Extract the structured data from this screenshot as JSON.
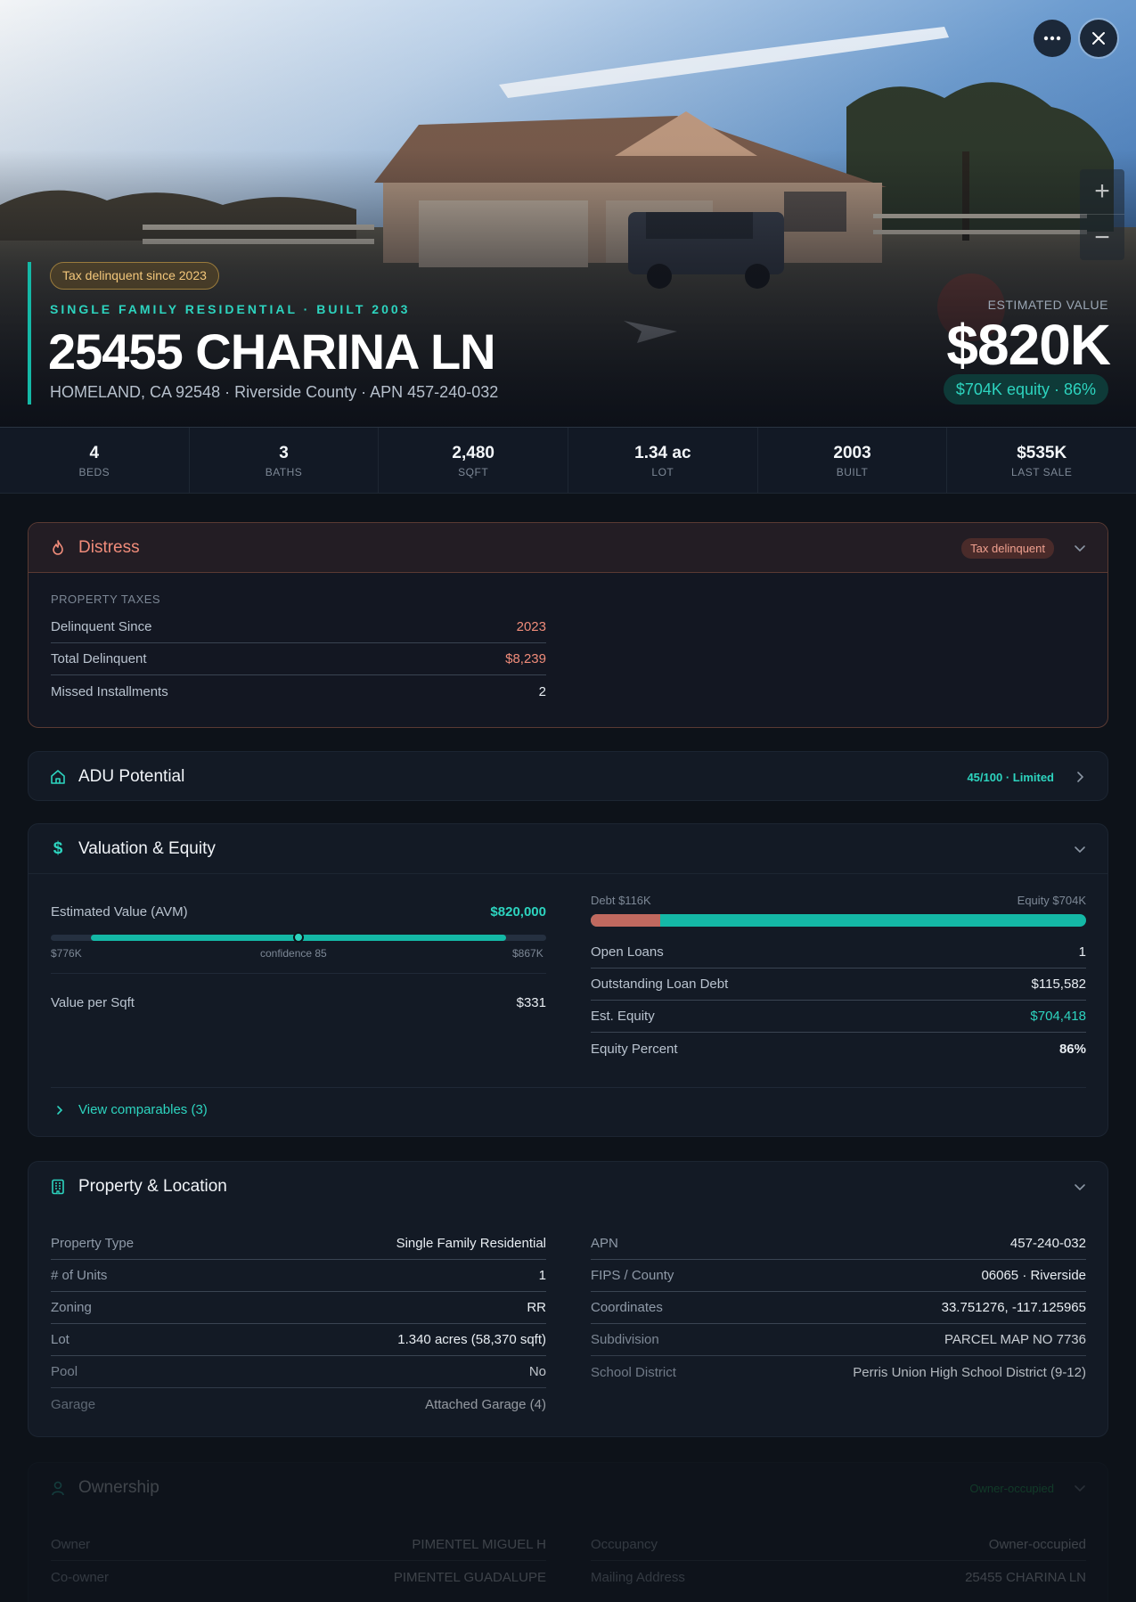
{
  "hero": {
    "tax_chip": "Tax delinquent since 2023",
    "kicker": "SINGLE FAMILY RESIDENTIAL · BUILT 2003",
    "address": "25455 CHARINA LN",
    "subline": "HOMELAND, CA 92548 · Riverside County · APN 457-240-032",
    "estimated_label": "ESTIMATED VALUE",
    "estimated_value": "$820K",
    "equity_pill": "$704K equity · 86%",
    "icons": {
      "more": "more-horizontal-icon",
      "close": "close-icon",
      "zoom_in": "plus-icon",
      "zoom_out": "minus-icon"
    }
  },
  "stats": [
    {
      "value": "4",
      "label": "BEDS"
    },
    {
      "value": "3",
      "label": "BATHS"
    },
    {
      "value": "2,480",
      "label": "SQFT"
    },
    {
      "value": "1.34 ac",
      "label": "LOT"
    },
    {
      "value": "2003",
      "label": "BUILT"
    },
    {
      "value": "$535K",
      "label": "LAST SALE"
    }
  ],
  "distress": {
    "title": "Distress",
    "badge": "Tax delinquent",
    "section": "PROPERTY TAXES",
    "rows": [
      {
        "k": "Delinquent Since",
        "v": "2023"
      },
      {
        "k": "Total Delinquent",
        "v": "$8,239"
      },
      {
        "k": "Missed Installments",
        "v": "2"
      }
    ]
  },
  "adu": {
    "title": "ADU Potential",
    "tag": "45/100 · Limited"
  },
  "valuation": {
    "title": "Valuation & Equity",
    "avm_label": "Estimated Value (AVM)",
    "avm_value": "$820,000",
    "range_low": "$776K",
    "confidence": "confidence 85",
    "range_high": "$867K",
    "value_per_sqft_label": "Value per Sqft",
    "value_per_sqft": "$331",
    "debt_label": "Debt $116K",
    "equity_label": "Equity $704K",
    "debt_fraction": 0.14,
    "rows": [
      {
        "k": "Open Loans",
        "v": "1"
      },
      {
        "k": "Outstanding Loan Debt",
        "v": "$115,582"
      },
      {
        "k": "Est. Equity",
        "v": "$704,418"
      },
      {
        "k": "Equity Percent",
        "v": "86%"
      }
    ],
    "comparables_link": "View comparables (3)"
  },
  "location": {
    "title": "Property & Location",
    "left": [
      {
        "k": "Property Type",
        "v": "Single Family Residential"
      },
      {
        "k": "# of Units",
        "v": "1"
      },
      {
        "k": "Zoning",
        "v": "RR"
      },
      {
        "k": "Lot",
        "v": "1.340 acres (58,370 sqft)"
      },
      {
        "k": "Pool",
        "v": "No"
      },
      {
        "k": "Garage",
        "v": "Attached Garage (4)"
      }
    ],
    "right": [
      {
        "k": "APN",
        "v": "457-240-032"
      },
      {
        "k": "FIPS / County",
        "v": "06065 · Riverside"
      },
      {
        "k": "Coordinates",
        "v": "33.751276, -117.125965"
      },
      {
        "k": "Subdivision",
        "v": "PARCEL MAP NO 7736"
      },
      {
        "k": "School District",
        "v": "Perris Union High School District (9-12)"
      }
    ]
  },
  "ownership": {
    "title": "Ownership",
    "tag": "Owner-occupied",
    "left": [
      {
        "k": "Owner",
        "v": "PIMENTEL MIGUEL H"
      },
      {
        "k": "Co-owner",
        "v": "PIMENTEL GUADALUPE"
      }
    ],
    "right": [
      {
        "k": "Occupancy",
        "v": "Owner-occupied"
      },
      {
        "k": "Mailing Address",
        "v": "25455 CHARINA LN"
      }
    ]
  },
  "colors": {
    "accent": "#2dd4bf",
    "danger": "#f08c7a",
    "warning": "#f3c77b",
    "bg": "#0d1219"
  }
}
